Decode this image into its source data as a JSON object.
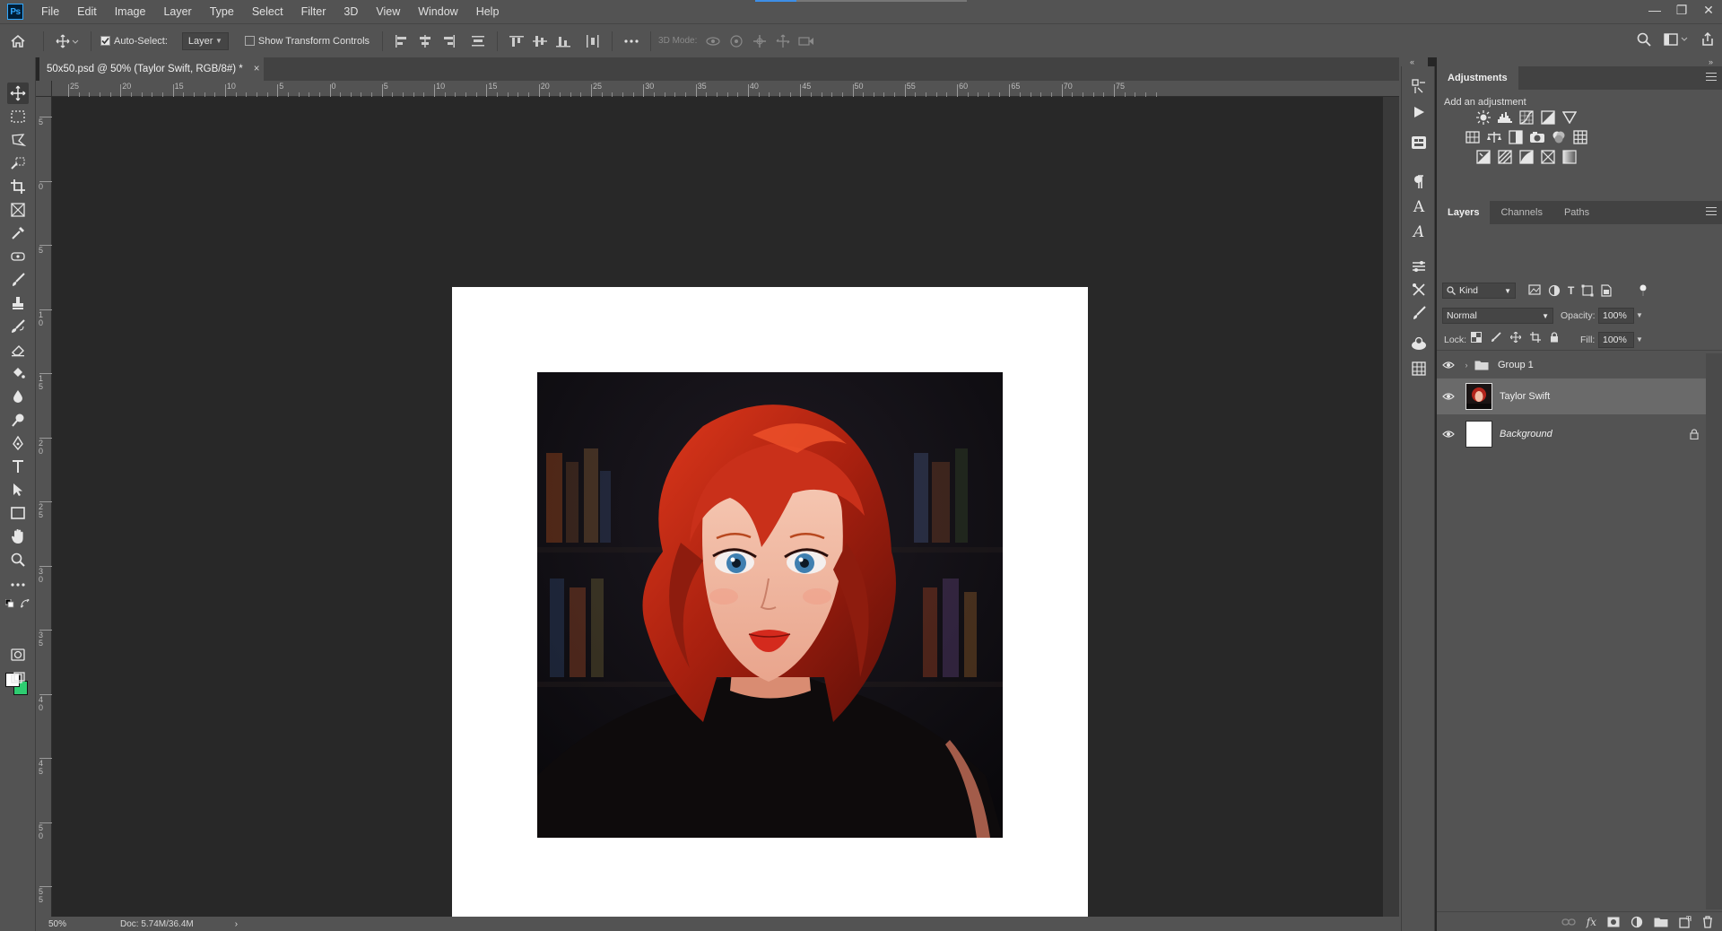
{
  "app": {
    "logo_text": "Ps"
  },
  "menu": [
    "File",
    "Edit",
    "Image",
    "Layer",
    "Type",
    "Select",
    "Filter",
    "3D",
    "View",
    "Window",
    "Help"
  ],
  "window_controls": {
    "minimize": "—",
    "restore": "❐",
    "close": "✕"
  },
  "options_bar": {
    "auto_select_label": "Auto-Select:",
    "auto_select_checked": true,
    "auto_select_target": "Layer",
    "show_transform_label": "Show Transform Controls",
    "show_transform_checked": false,
    "mode_3d_label": "3D Mode:"
  },
  "document_tab": {
    "title": "50x50.psd @ 50% (Taylor Swift, RGB/8#) *",
    "close": "×"
  },
  "ruler_top_labels": [
    "25",
    "20",
    "15",
    "10",
    "5",
    "0",
    "5",
    "10",
    "15",
    "20",
    "25",
    "30",
    "35",
    "40",
    "45",
    "50",
    "55",
    "60",
    "65",
    "70",
    "75"
  ],
  "ruler_left_labels": [
    "5",
    "0",
    "5",
    "1 0",
    "1 5",
    "2 0",
    "2 5",
    "3 0",
    "3 5",
    "4 0",
    "4 5",
    "5 0",
    "5 5"
  ],
  "status_bar": {
    "zoom": "50%",
    "doc": "Doc: 5.74M/36.4M",
    "arrow": "›"
  },
  "colors": {
    "foreground": "#ffffff",
    "background": "#2ecc71"
  },
  "adjustments": {
    "tab_label": "Adjustments",
    "subtitle": "Add an adjustment"
  },
  "layers_panel": {
    "tabs": [
      "Layers",
      "Channels",
      "Paths"
    ],
    "filter_kind": "Kind",
    "blend_mode": "Normal",
    "opacity_label": "Opacity:",
    "opacity_value": "100%",
    "lock_label": "Lock:",
    "fill_label": "Fill:",
    "fill_value": "100%",
    "layers": [
      {
        "name": "Group 1",
        "type": "group",
        "visible": true,
        "selected": false
      },
      {
        "name": "Taylor Swift",
        "type": "image",
        "visible": true,
        "selected": true
      },
      {
        "name": "Background",
        "type": "background",
        "visible": true,
        "selected": false,
        "locked": true
      }
    ]
  }
}
